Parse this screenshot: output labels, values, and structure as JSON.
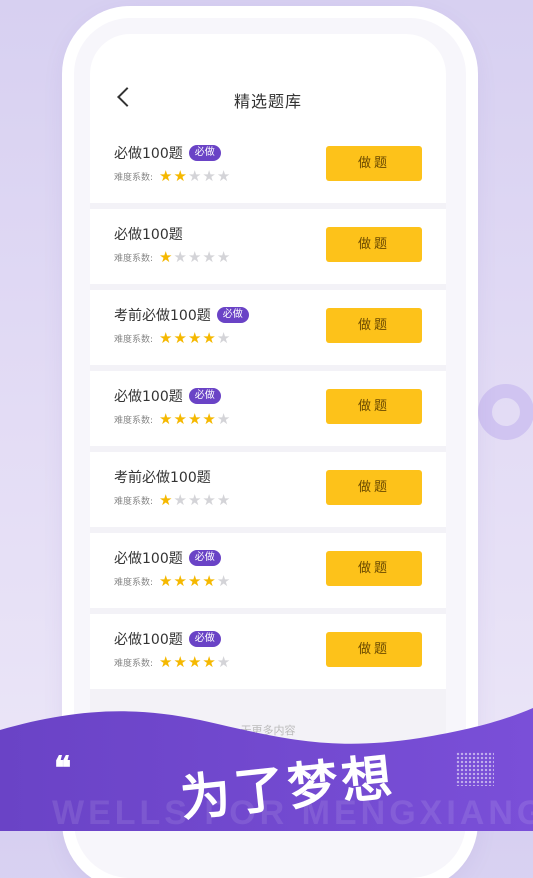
{
  "header": {
    "title": "精选题库"
  },
  "difficulty_label": "难度系数:",
  "action_label": "做题",
  "items": [
    {
      "name": "必做100题",
      "badge": "必做",
      "stars": 2
    },
    {
      "name": "必做100题",
      "badge": "",
      "stars": 1
    },
    {
      "name": "考前必做100题",
      "badge": "必做",
      "stars": 4
    },
    {
      "name": "必做100题",
      "badge": "必做",
      "stars": 4
    },
    {
      "name": "考前必做100题",
      "badge": "",
      "stars": 1
    },
    {
      "name": "必做100题",
      "badge": "必做",
      "stars": 4
    },
    {
      "name": "必做100题",
      "badge": "必做",
      "stars": 4
    }
  ],
  "max_stars": 5,
  "footer_text": "无更多内容",
  "banner": {
    "quote": "❝",
    "slogan": "为了梦想",
    "watermark": "WELLS FOR MENGXIANG"
  },
  "colors": {
    "accent": "#6a43c6",
    "button": "#fdc21a",
    "star_on": "#f5b800",
    "star_off": "#d4d4d8"
  }
}
